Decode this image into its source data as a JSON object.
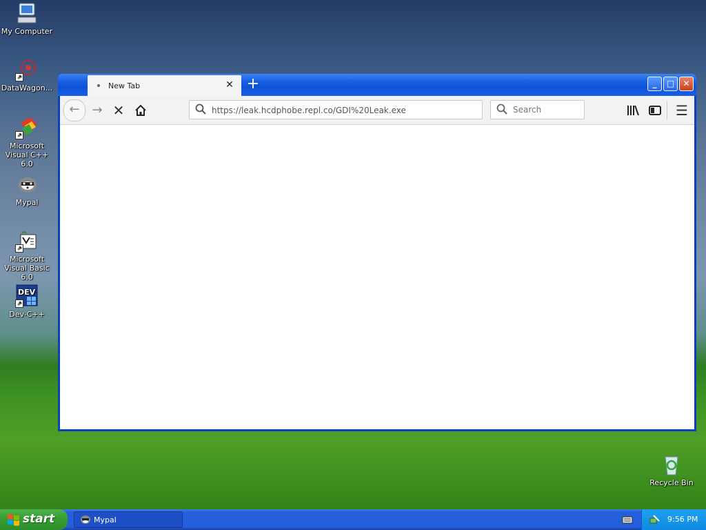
{
  "desktop": {
    "icons": [
      {
        "label": "My Computer",
        "icon": "computer-icon"
      },
      {
        "label": "DataWagon...",
        "icon": "datawagon-icon"
      },
      {
        "label": "Microsoft Visual C++ 6.0",
        "icon": "visual-cpp-icon"
      },
      {
        "label": "Mypal",
        "icon": "mypal-icon"
      },
      {
        "label": "Microsoft Visual Basic 6.0",
        "icon": "visual-basic-icon"
      },
      {
        "label": "Dev-C++",
        "icon": "dev-cpp-icon"
      },
      {
        "label": "Recycle Bin",
        "icon": "recycle-bin-icon"
      }
    ]
  },
  "browser": {
    "tab_title": "New Tab",
    "url": "https://leak.hcdphobe.repl.co/GDI%20Leak.exe",
    "search_placeholder": "Search"
  },
  "taskbar": {
    "start_label": "start",
    "tasks": [
      {
        "label": "Mypal"
      }
    ],
    "clock": "9:56 PM"
  }
}
